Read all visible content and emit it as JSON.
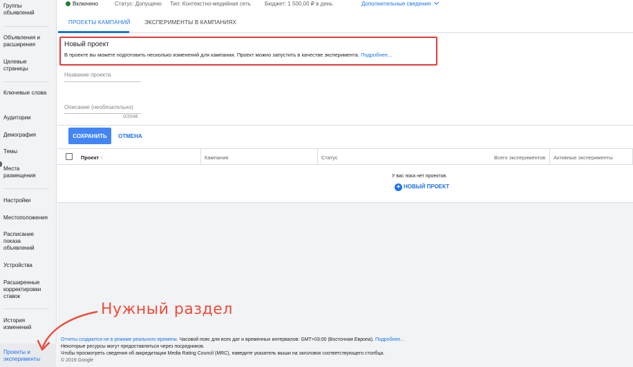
{
  "sidebar": {
    "items": [
      {
        "label": "Группы объявлений"
      },
      {
        "label": "Объявления и расширения"
      },
      {
        "label": "Целевые страницы"
      },
      {
        "label": "Ключевые слова"
      },
      {
        "label": "Аудитории"
      },
      {
        "label": "Демография"
      },
      {
        "label": "Темы"
      },
      {
        "label": "Места размещения"
      },
      {
        "label": "Настройки"
      },
      {
        "label": "Местоположения"
      },
      {
        "label": "Расписание показа объявлений"
      },
      {
        "label": "Устройства"
      },
      {
        "label": "Расширенные корректировки ставок"
      },
      {
        "label": "История изменений"
      },
      {
        "label": "Проекты и эксперименты"
      }
    ]
  },
  "status_bar": {
    "status": "Включено",
    "moderation": "Статус: Допущено",
    "type": "Тип: Контекстно-медийная сеть",
    "budget": "Бюджет: 1 500,00 ₽ в день",
    "more": "Дополнительные сведения"
  },
  "tabs": [
    {
      "label": "ПРОЕКТЫ КАМПАНИЙ"
    },
    {
      "label": "ЭКСПЕРИМЕНТЫ В КАМПАНИЯХ"
    }
  ],
  "new_project": {
    "title": "Новый проект",
    "description": "В проекте вы можете подготовить несколько изменений для кампании. Проект можно запустить в качестве эксперимента.",
    "more_link": "Подробнее..."
  },
  "form": {
    "name_label": "Название проекта",
    "desc_label": "Описание (необязательно)",
    "char_count": "0/2048",
    "save": "СОХРАНИТЬ",
    "cancel": "ОТМЕНА"
  },
  "table": {
    "columns": [
      "Проект",
      "Кампания",
      "Статус",
      "Всего экспериментов",
      "Активные эксперименты"
    ],
    "empty_text": "У вас пока нет проектов.",
    "new_project": "НОВЫЙ ПРОЕКТ"
  },
  "footer": {
    "line1_link": "Отчеты создаются не в режиме реального времени.",
    "line1_text": "Часовой пояс для всех дат и временных интервалов: GMT+03:00 (Восточная Европа).",
    "line1_more": "Подробнее...",
    "line2": "Некоторые ресурсы могут предоставляться через посредников.",
    "line3": "Чтобы просмотреть сведения об аккредитации Media Rating Council (MRC), наведите указатель мыши на заголовок соответствующего столбца.",
    "copyright": "© 2019 Google"
  },
  "annotation": {
    "text": "Нужный раздел",
    "color": "#f04b3a"
  },
  "colors": {
    "accent": "#1a73e8",
    "save_button": "#4285f4",
    "highlight_border": "#e53935",
    "status_enabled": "#188038"
  }
}
